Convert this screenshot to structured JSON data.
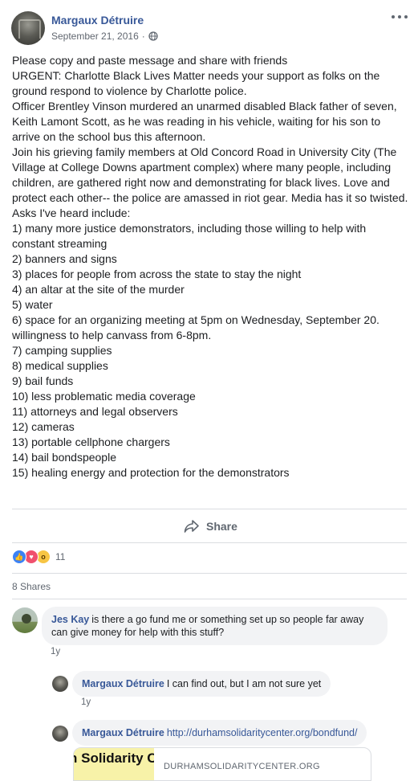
{
  "post": {
    "author": "Margaux Détruire",
    "date": "September 21, 2016",
    "separator": "·",
    "visibility_icon": "globe-icon",
    "more_icon": "more-options-icon",
    "body": [
      "Please copy and paste message and share with friends",
      "URGENT: Charlotte Black Lives Matter needs your support as folks on the ground respond to violence by Charlotte police.",
      "Officer Brentley Vinson murdered an unarmed disabled Black father of seven, Keith Lamont Scott, as he was reading in his vehicle, waiting for his son to arrive on the school bus this afternoon.",
      "Join his grieving family members at Old Concord Road in University City (The Village at College Downs apartment complex) where many people, including children, are gathered right now and demonstrating for black lives. Love and protect each other-- the police are amassed in riot gear. Media has it so twisted.",
      "Asks I've heard include:",
      "1) many more justice demonstrators, including those willing to help with constant streaming",
      "2) banners and signs",
      "3) places for people from across the state to stay the night",
      "4) an altar at the site of the murder",
      "5) water",
      "6) space for an organizing meeting at 5pm on Wednesday, September 20. willingness to help canvass from 6-8pm.",
      "7) camping supplies",
      "8) medical supplies",
      "9) bail funds",
      "10) less problematic media coverage",
      "11) attorneys and legal observers",
      "12) cameras",
      "13) portable cellphone chargers",
      "14) bail bondspeople",
      "15) healing energy and protection for the demonstrators"
    ]
  },
  "actions": {
    "share_label": "Share",
    "share_icon": "share-arrow-icon"
  },
  "reactions": {
    "types": [
      "like",
      "love",
      "wow"
    ],
    "count": "11"
  },
  "shares": "8 Shares",
  "comments": [
    {
      "author": "Jes Kay",
      "text": "is there a go fund me or something set up so people far away can give money for help with this stuff?",
      "time": "1y"
    },
    {
      "author": "Margaux Détruire",
      "text": "I can find out, but I am not sure yet",
      "time": "1y"
    },
    {
      "author": "Margaux Détruire",
      "link": "http://durhamsolidaritycenter.org/bondfund/",
      "preview_thumb_text": "n Solidarity C",
      "preview_domain": "DURHAMSOLIDARITYCENTER.ORG"
    }
  ],
  "colors": {
    "link_blue": "#385898",
    "meta_gray": "#606770",
    "bubble_bg": "#f2f3f5",
    "like_blue": "#3b82f6",
    "love_red": "#f0506e",
    "wow_yellow": "#f7c544"
  }
}
